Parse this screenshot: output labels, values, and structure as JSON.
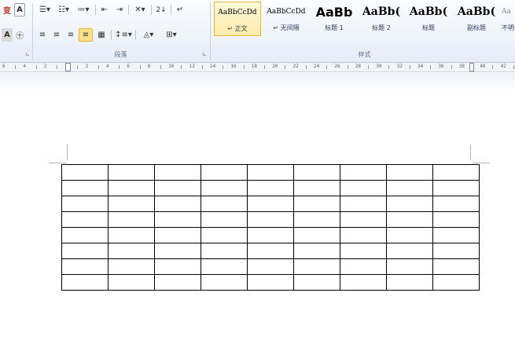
{
  "ribbon": {
    "font_group": {
      "phonetic_label": "变",
      "char_border_label": "A",
      "char_shading_label": "A",
      "enclosed_label": "㊉"
    },
    "paragraph_group": {
      "label": "段落",
      "icons": [
        "bullets-icon",
        "numbering-icon",
        "multilevel-list-icon",
        "decrease-indent-icon",
        "increase-indent-icon",
        "chinese-layout-icon",
        "sort-icon",
        "show-marks-icon",
        "align-left-icon",
        "center-icon",
        "align-right-icon",
        "justify-icon",
        "distributed-icon",
        "line-spacing-icon",
        "shading-icon",
        "borders-icon"
      ],
      "sort_label": "2↓",
      "show_marks_label": "↵",
      "active_alignment": "justify"
    },
    "styles_group": {
      "label": "样式",
      "styles": [
        {
          "sample": "AaBbCcDd",
          "name": "↵ 正文",
          "selected": true
        },
        {
          "sample": "AaBbCcDd",
          "name": "↵ 无间隔",
          "selected": false
        },
        {
          "sample": "AaBb",
          "name": "标题 1",
          "selected": false
        },
        {
          "sample": "AaBb(",
          "name": "标题 2",
          "selected": false
        },
        {
          "sample": "AaBb(",
          "name": "标题",
          "selected": false
        },
        {
          "sample": "AaBb(",
          "name": "副标题",
          "selected": false
        },
        {
          "sample": "Aa",
          "name": "不明",
          "selected": false
        }
      ]
    }
  },
  "ruler": {
    "numbers": [
      "6",
      "4",
      "2",
      "",
      "2",
      "4",
      "6",
      "8",
      "10",
      "12",
      "14",
      "16",
      "18",
      "20",
      "22",
      "24",
      "26",
      "28",
      "30",
      "32",
      "34",
      "36",
      "38",
      "40",
      "42"
    ]
  },
  "document": {
    "table": {
      "rows": 8,
      "cols": 9
    }
  },
  "colors": {
    "ribbon_bg": "#e6edf7",
    "selected_style": "#ffeaa8",
    "table_border": "#000000"
  }
}
